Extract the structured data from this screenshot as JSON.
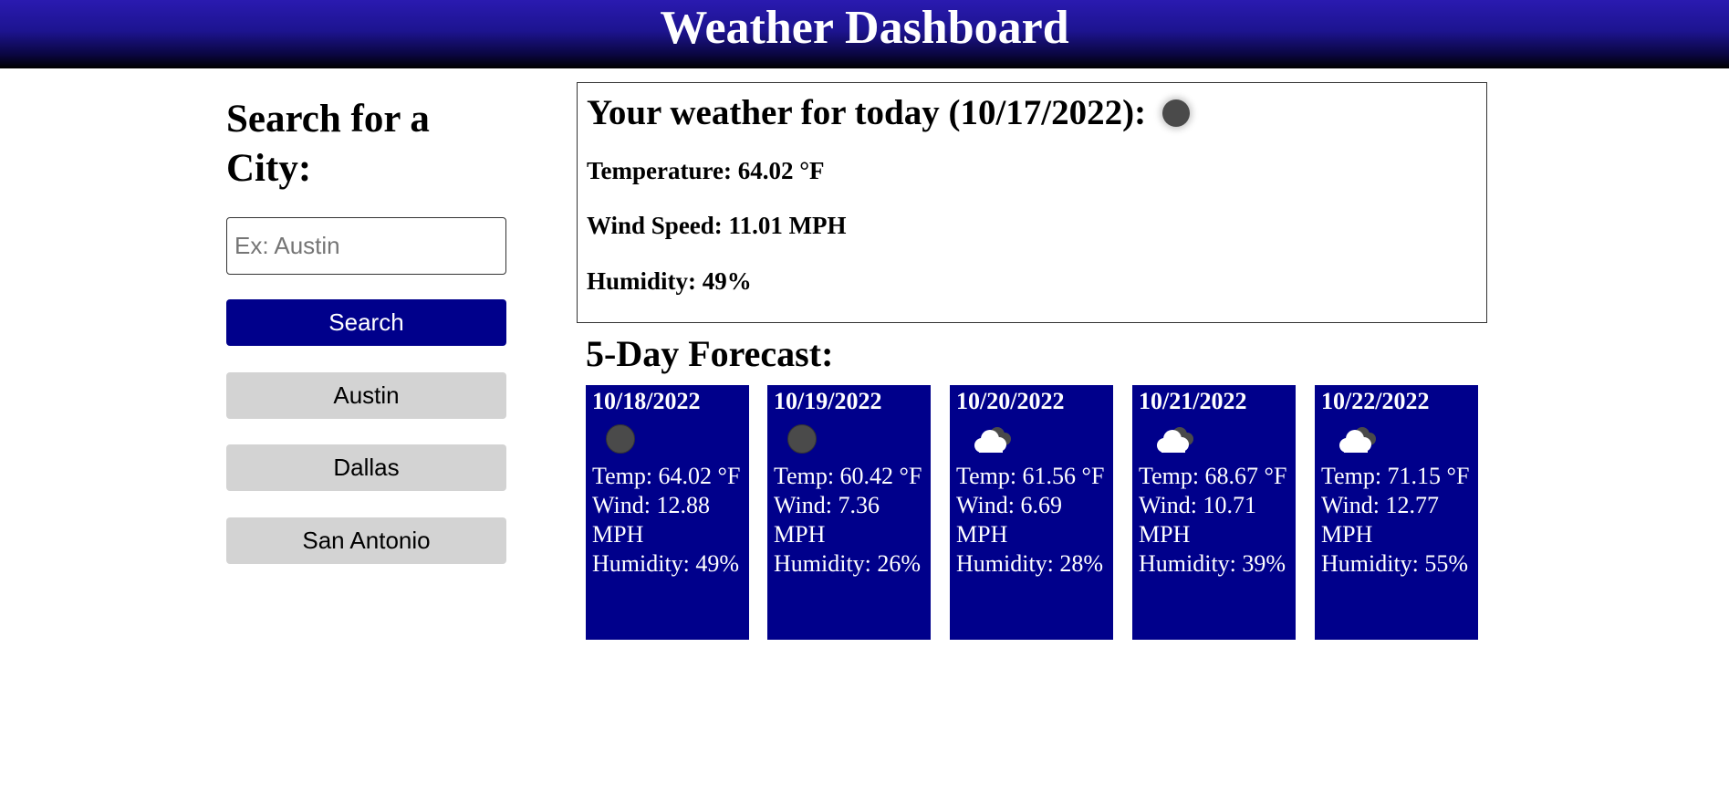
{
  "header": {
    "title": "Weather Dashboard"
  },
  "sidebar": {
    "heading": "Search for a City:",
    "search_placeholder": "Ex: Austin",
    "search_value": "",
    "search_button": "Search",
    "history": [
      "Austin",
      "Dallas",
      "San Antonio"
    ]
  },
  "today": {
    "title": "Your weather for today (10/17/2022):",
    "icon": "moon-icon",
    "temperature": "Temperature: 64.02 °F",
    "wind": "Wind Speed: 11.01 MPH",
    "humidity": "Humidity: 49%"
  },
  "forecast": {
    "title": "5-Day Forecast:",
    "days": [
      {
        "date": "10/18/2022",
        "icon": "moon-icon",
        "temp": "Temp: 64.02 °F",
        "wind": "Wind: 12.88 MPH",
        "humidity": "Humidity: 49%"
      },
      {
        "date": "10/19/2022",
        "icon": "moon-icon",
        "temp": "Temp: 60.42 °F",
        "wind": "Wind: 7.36 MPH",
        "humidity": "Humidity: 26%"
      },
      {
        "date": "10/20/2022",
        "icon": "cloud-icon",
        "temp": "Temp: 61.56 °F",
        "wind": "Wind: 6.69 MPH",
        "humidity": "Humidity: 28%"
      },
      {
        "date": "10/21/2022",
        "icon": "cloud-icon",
        "temp": "Temp: 68.67 °F",
        "wind": "Wind: 10.71 MPH",
        "humidity": "Humidity: 39%"
      },
      {
        "date": "10/22/2022",
        "icon": "cloud-icon",
        "temp": "Temp: 71.15 °F",
        "wind": "Wind: 12.77 MPH",
        "humidity": "Humidity: 55%"
      }
    ]
  },
  "colors": {
    "header_gradient_top": "#2a1ab0",
    "header_gradient_bottom": "#000000",
    "primary": "#00008b",
    "history_button": "#d3d3d3"
  }
}
